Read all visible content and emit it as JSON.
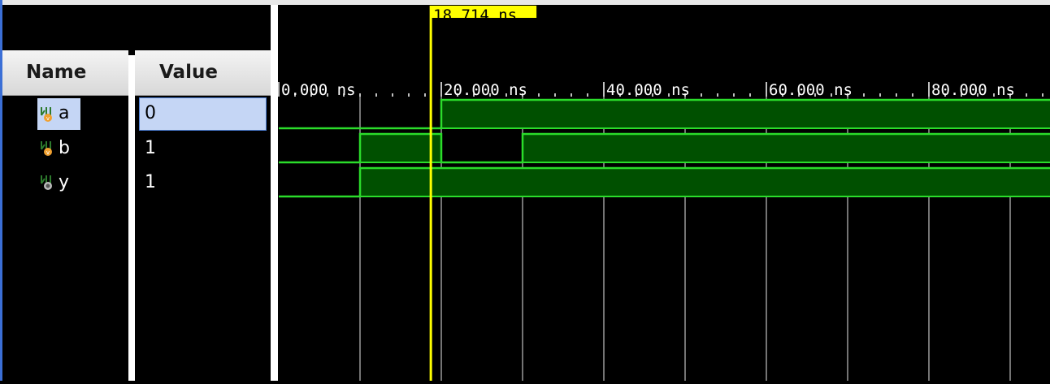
{
  "columns": {
    "name_header": "Name",
    "value_header": "Value"
  },
  "signals": [
    {
      "name": "a",
      "value": "0",
      "icon": "input-signal-icon"
    },
    {
      "name": "b",
      "value": "1",
      "icon": "input-signal-icon"
    },
    {
      "name": "y",
      "value": "1",
      "icon": "output-signal-icon"
    }
  ],
  "timeline": {
    "cursor_label": "18.714 ns",
    "ticks": [
      "0.000 ns",
      "20.000 ns",
      "40.000 ns",
      "60.000 ns",
      "80.000 ns"
    ]
  },
  "colors": {
    "waveform_fill": "#005000",
    "waveform_line": "#2bdc2b",
    "cursor": "#ffff00",
    "grid": "#9a9a9a"
  }
}
